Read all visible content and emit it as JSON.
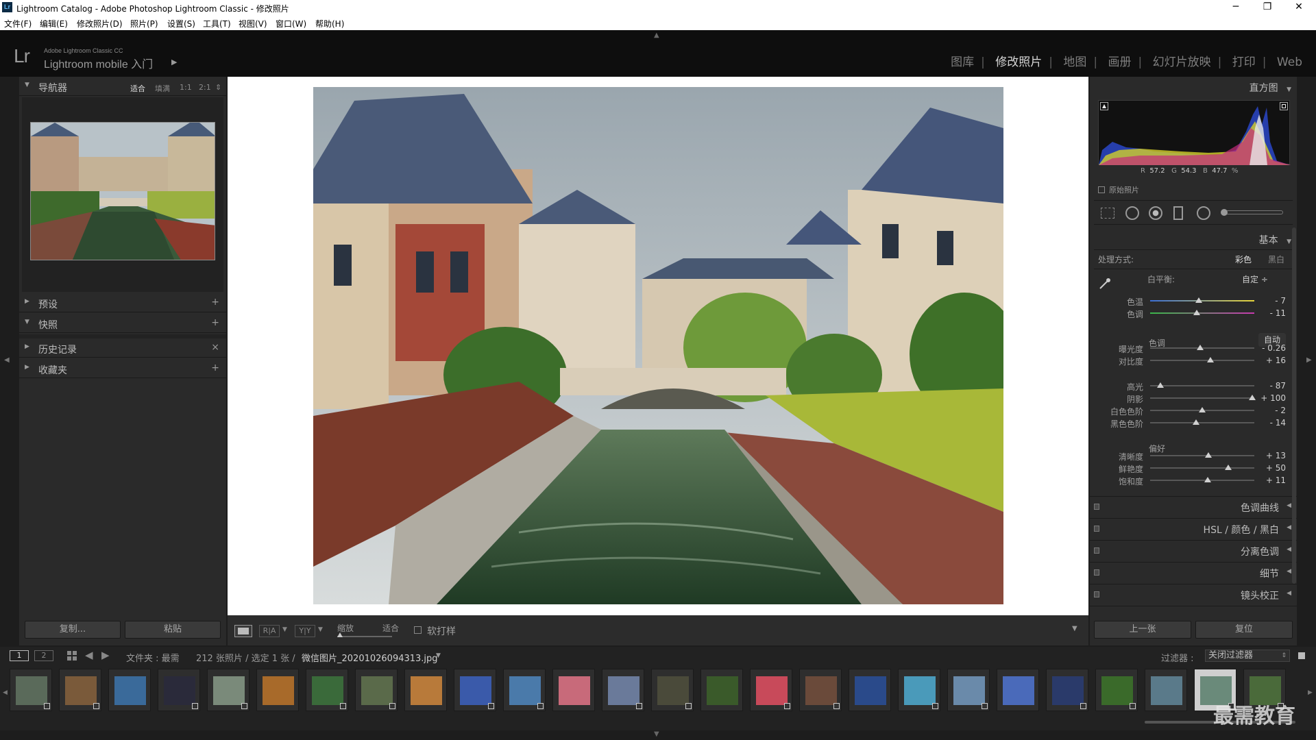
{
  "window": {
    "title": "Lightroom Catalog - Adobe Photoshop Lightroom Classic - 修改照片",
    "app_icon": "Lr",
    "minimize": "─",
    "maximize": "❐",
    "close": "✕"
  },
  "menu": [
    "文件(F)",
    "编辑(E)",
    "修改照片(D)",
    "照片(P)",
    "设置(S)",
    "工具(T)",
    "视图(V)",
    "窗口(W)",
    "帮助(H)"
  ],
  "identity": {
    "logo": "Lr",
    "product_small": "Adobe Lightroom Classic CC",
    "product_big": "Lightroom mobile 入门",
    "arrow": "▶"
  },
  "modules": [
    "图库",
    "修改照片",
    "地图",
    "画册",
    "幻灯片放映",
    "打印",
    "Web"
  ],
  "active_module": "修改照片",
  "left_panel": {
    "navigator": {
      "label": "导航器",
      "zoom_options": [
        "适合",
        "填满",
        "1:1",
        "2:1"
      ],
      "zoom_active": "适合",
      "zoom_more": "⇕"
    },
    "sections": [
      {
        "label": "预设",
        "action": "+",
        "open": false
      },
      {
        "label": "快照",
        "action": "+",
        "open": true
      },
      {
        "label": "历史记录",
        "action": "×",
        "open": false
      },
      {
        "label": "收藏夹",
        "action": "+",
        "open": false
      }
    ],
    "copy_button": "复制...",
    "paste_button": "粘贴"
  },
  "toolbar": {
    "zoom_label": "缩放",
    "fit_label": "适合",
    "softproof_label": "软打样",
    "ra_label": "R|A",
    "yy_label": "Y|Y"
  },
  "right_panel": {
    "histogram": {
      "label": "直方图",
      "r_label": "R",
      "r_value": "57.2",
      "g_label": "G",
      "g_value": "54.3",
      "b_label": "B",
      "b_value": "47.7",
      "unit": "%",
      "original_label": "原始照片"
    },
    "basic": {
      "label": "基本",
      "treatment_label": "处理方式:",
      "treatment_color": "彩色",
      "treatment_bw": "黑白",
      "wb_label": "白平衡:",
      "wb_value": "自定 ÷",
      "tone_label": "色调",
      "tone_auto": "自动",
      "presence_label": "偏好",
      "sliders": [
        {
          "label": "色温",
          "value": "- 7",
          "pos": 0.47,
          "group": "wb"
        },
        {
          "label": "色调",
          "value": "- 11",
          "pos": 0.45,
          "group": "wb"
        },
        {
          "label": "曝光度",
          "value": "- 0.26",
          "pos": 0.48,
          "group": "tone"
        },
        {
          "label": "对比度",
          "value": "+ 16",
          "pos": 0.58,
          "group": "tone"
        },
        {
          "label": "高光",
          "value": "- 87",
          "pos": 0.1,
          "group": "tone2"
        },
        {
          "label": "阴影",
          "value": "+ 100",
          "pos": 0.98,
          "group": "tone2"
        },
        {
          "label": "白色色阶",
          "value": "- 2",
          "pos": 0.5,
          "group": "tone2"
        },
        {
          "label": "黑色色阶",
          "value": "- 14",
          "pos": 0.44,
          "group": "tone2"
        },
        {
          "label": "清晰度",
          "value": "+ 13",
          "pos": 0.56,
          "group": "presence"
        },
        {
          "label": "鲜艳度",
          "value": "+ 50",
          "pos": 0.75,
          "group": "presence"
        },
        {
          "label": "饱和度",
          "value": "+ 11",
          "pos": 0.55,
          "group": "presence"
        }
      ]
    },
    "collapsed_panels": [
      "色调曲线",
      "HSL / 颜色 / 黑白",
      "分离色调",
      "细节",
      "镜头校正"
    ],
    "prev_button": "上一张",
    "reset_button": "复位"
  },
  "filmstrip_bar": {
    "screen1": "1",
    "screen2": "2",
    "path": "文件夹 : 最需",
    "count": "212 张照片 / 选定 1 张 /",
    "filename": "微信图片_20201026094313.jpg",
    "filter_label": "过滤器 :",
    "filter_value": "关闭过滤器"
  },
  "watermark": "最需教育",
  "colors": {
    "bg": "#1d1d1d",
    "panel": "#2a2a2a",
    "active_text": "#d6d6d6"
  }
}
